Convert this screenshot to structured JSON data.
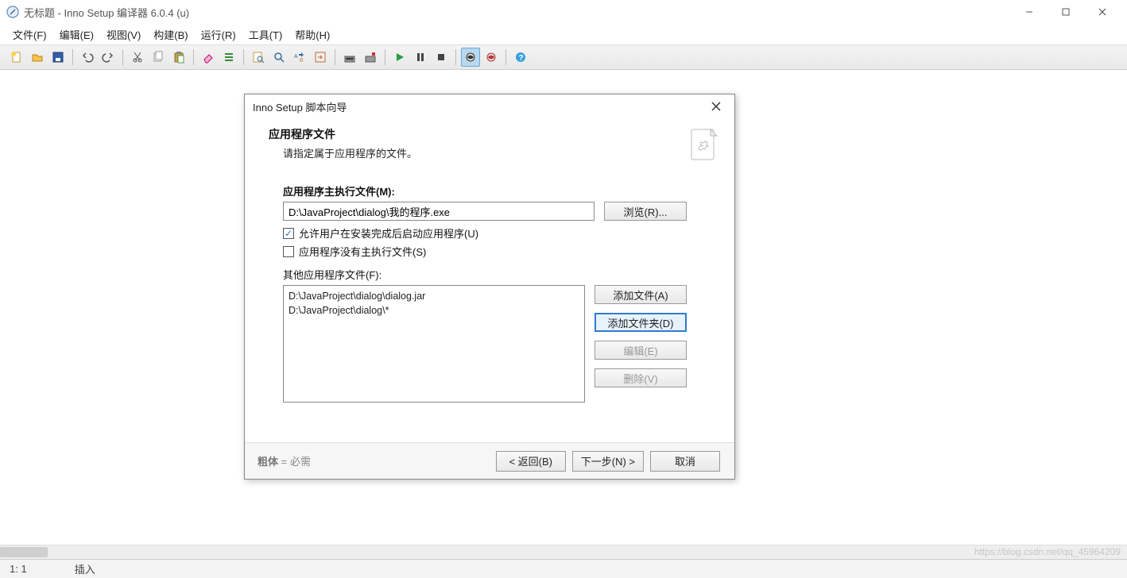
{
  "window": {
    "title": "无标题 - Inno Setup 编译器 6.0.4 (u)"
  },
  "menu": {
    "file": "文件(F)",
    "edit": "编辑(E)",
    "view": "视图(V)",
    "build": "构建(B)",
    "run": "运行(R)",
    "tools": "工具(T)",
    "help": "帮助(H)"
  },
  "dialog": {
    "title": "Inno Setup 脚本向导",
    "heading": "应用程序文件",
    "subheading": "请指定属于应用程序的文件。",
    "main_exe_label": "应用程序主执行文件(M):",
    "main_exe_value": "D:\\JavaProject\\dialog\\我的程序.exe",
    "browse": "浏览(R)...",
    "cb_allow_run": "允许用户在安装完成后启动应用程序(U)",
    "cb_no_main": "应用程序没有主执行文件(S)",
    "other_files_label": "其他应用程序文件(F):",
    "other_files": [
      "D:\\JavaProject\\dialog\\dialog.jar",
      "D:\\JavaProject\\dialog\\*"
    ],
    "add_file": "添加文件(A)",
    "add_folder": "添加文件夹(D)",
    "edit_btn": "编辑(E)",
    "delete_btn": "删除(V)",
    "hint_bold": "粗体",
    "hint_rest": " = 必需",
    "back": "< 返回(B)",
    "next": "下一步(N) >",
    "cancel": "取消"
  },
  "status": {
    "pos": "1:   1",
    "mode": "插入"
  },
  "watermark": "https://blog.csdn.net/qq_45964209"
}
